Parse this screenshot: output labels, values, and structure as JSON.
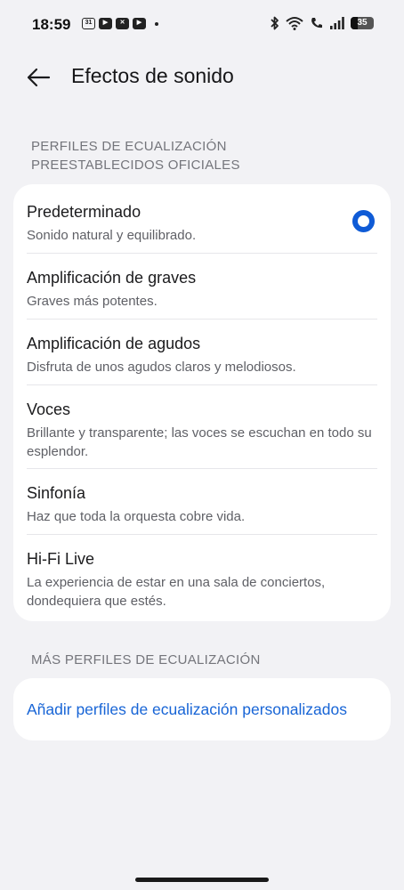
{
  "status_bar": {
    "time": "18:59",
    "notification_icons": [
      "calendar-icon",
      "youtube-icon",
      "x-icon",
      "youtube-icon"
    ],
    "calendar_day": "31",
    "battery_level": "35"
  },
  "header": {
    "title": "Efectos de sonido"
  },
  "preset_section": {
    "title": "PERFILES DE ECUALIZACIÓN PREESTABLECIDOS OFICIALES",
    "items": [
      {
        "title": "Predeterminado",
        "description": "Sonido natural y equilibrado.",
        "selected": true
      },
      {
        "title": "Amplificación de graves",
        "description": "Graves más potentes.",
        "selected": false
      },
      {
        "title": "Amplificación de agudos",
        "description": "Disfruta de unos agudos claros y melodiosos.",
        "selected": false
      },
      {
        "title": "Voces",
        "description": "Brillante y transparente; las voces se escuchan en todo su esplendor.",
        "selected": false
      },
      {
        "title": "Sinfonía",
        "description": "Haz que toda la orquesta cobre vida.",
        "selected": false
      },
      {
        "title": "Hi-Fi Live",
        "description": "La experiencia de estar en una sala de conciertos, dondequiera que estés.",
        "selected": false
      }
    ]
  },
  "more_section": {
    "title": "MÁS PERFILES DE ECUALIZACIÓN",
    "add_label": "Añadir perfiles de ecualización personalizados"
  },
  "colors": {
    "accent": "#1865d6",
    "radio": "#0f5bd6",
    "background": "#f2f2f5",
    "card": "#ffffff"
  }
}
